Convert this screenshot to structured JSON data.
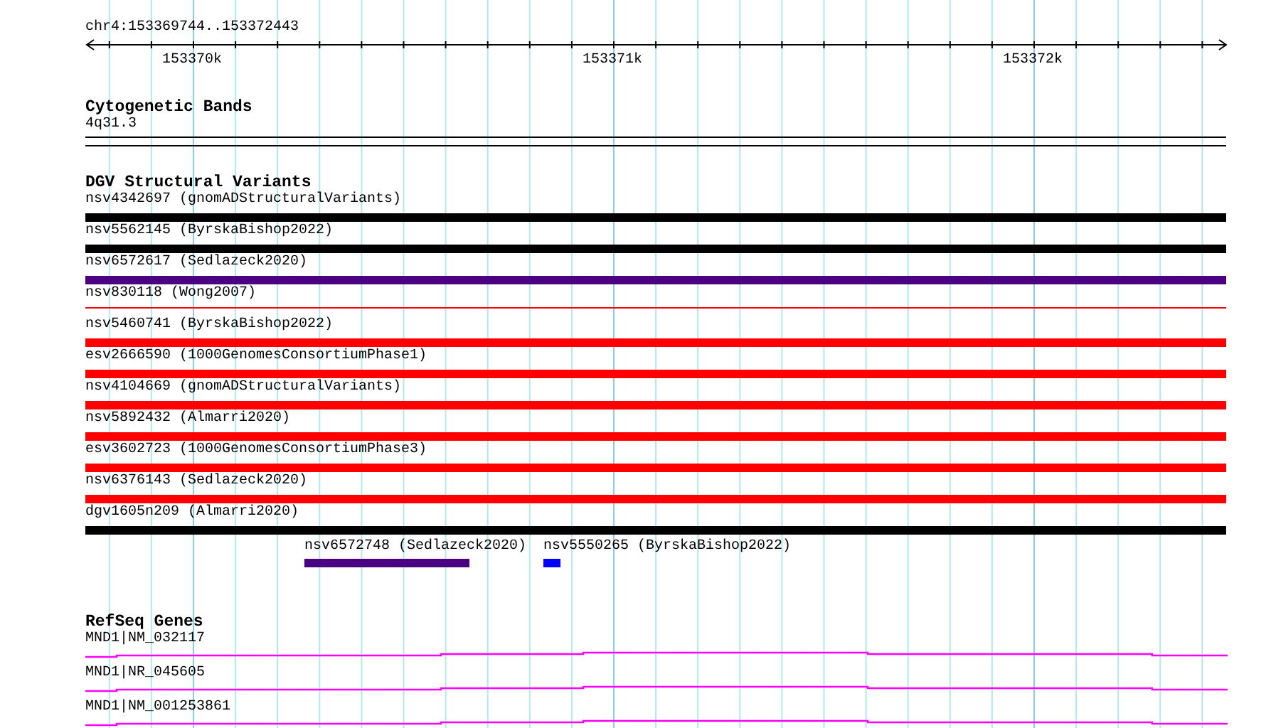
{
  "ruler": {
    "location": "chr4:153369744..153372443",
    "tick_labels": [
      "153370k",
      "153371k",
      "153372k"
    ]
  },
  "cytogenetic_bands": {
    "title": "Cytogenetic Bands",
    "band": "4q31.3"
  },
  "dgv_structural_variants": {
    "title": "DGV Structural Variants",
    "rows": [
      {
        "label": "nsv4342697 (gnomADStructuralVariants)",
        "color": "#000000",
        "kind": "thick"
      },
      {
        "label": "nsv5562145 (ByrskaBishop2022)",
        "color": "#000000",
        "kind": "thick"
      },
      {
        "label": "nsv6572617 (Sedlazeck2020)",
        "color": "#4b0082",
        "kind": "thick"
      },
      {
        "label": "nsv830118 (Wong2007)",
        "color": "#ff0000",
        "kind": "thin"
      },
      {
        "label": "nsv5460741 (ByrskaBishop2022)",
        "color": "#ff0000",
        "kind": "thick"
      },
      {
        "label": "esv2666590 (1000GenomesConsortiumPhase1)",
        "color": "#ff0000",
        "kind": "thick"
      },
      {
        "label": "nsv4104669 (gnomADStructuralVariants)",
        "color": "#ff0000",
        "kind": "thick"
      },
      {
        "label": "nsv5892432 (Almarri2020)",
        "color": "#ff0000",
        "kind": "thick"
      },
      {
        "label": "esv3602723 (1000GenomesConsortiumPhase3)",
        "color": "#ff0000",
        "kind": "thick"
      },
      {
        "label": "nsv6376143 (Sedlazeck2020)",
        "color": "#ff0000",
        "kind": "thick"
      },
      {
        "label": "dgv1605n209 (Almarri2020)",
        "color": "#000000",
        "kind": "thick"
      }
    ],
    "short_variants": [
      {
        "label": "nsv6572748 (Sedlazeck2020)",
        "color": "#4b0082"
      },
      {
        "label": "nsv5550265 (ByrskaBishop2022)",
        "color": "#0000ff"
      }
    ]
  },
  "refseq_genes": {
    "title": "RefSeq Genes",
    "genes": [
      {
        "label": "MND1|NM_032117"
      },
      {
        "label": "MND1|NR_045605"
      },
      {
        "label": "MND1|NM_001253861"
      }
    ]
  }
}
